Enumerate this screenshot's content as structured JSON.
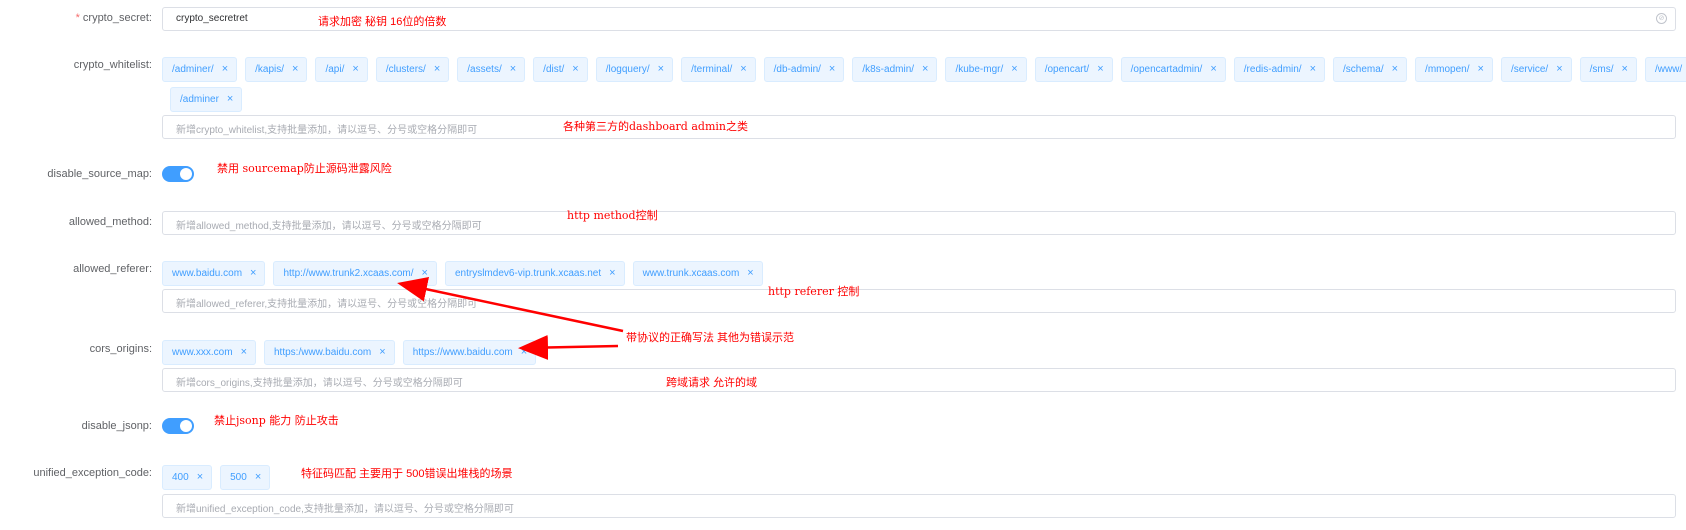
{
  "form": {
    "crypto_secret": {
      "label": "crypto_secret:",
      "required_mark": "*",
      "value": "crypto_secretret"
    },
    "crypto_whitelist": {
      "label": "crypto_whitelist:",
      "tags": [
        "/adminer/",
        "/kapis/",
        "/api/",
        "/clusters/",
        "/assets/",
        "/dist/",
        "/logquery/",
        "/terminal/",
        "/db-admin/",
        "/k8s-admin/",
        "/kube-mgr/",
        "/opencart/",
        "/opencartadmin/",
        "/redis-admin/",
        "/schema/",
        "/mmopen/",
        "/service/",
        "/sms/",
        "/www/"
      ],
      "tags_row2": [
        "/adminer"
      ],
      "placeholder": "新增crypto_whitelist,支持批量添加，请以逗号、分号或空格分隔即可"
    },
    "disable_source_map": {
      "label": "disable_source_map:",
      "enabled": true
    },
    "allowed_method": {
      "label": "allowed_method:",
      "placeholder": "新增allowed_method,支持批量添加，请以逗号、分号或空格分隔即可"
    },
    "allowed_referer": {
      "label": "allowed_referer:",
      "tags": [
        "www.baidu.com",
        "http://www.trunk2.xcaas.com/",
        "entryslmdev6-vip.trunk.xcaas.net",
        "www.trunk.xcaas.com"
      ],
      "placeholder": "新增allowed_referer,支持批量添加，请以逗号、分号或空格分隔即可"
    },
    "cors_origins": {
      "label": "cors_origins:",
      "tags": [
        "www.xxx.com",
        "https:/www.baidu.com",
        "https://www.baidu.com"
      ],
      "placeholder": "新增cors_origins,支持批量添加，请以逗号、分号或空格分隔即可"
    },
    "disable_jsonp": {
      "label": "disable_jsonp:",
      "enabled": true
    },
    "unified_exception_code": {
      "label": "unified_exception_code:",
      "tags": [
        "400",
        "500"
      ],
      "placeholder": "新增unified_exception_code,支持批量添加，请以逗号、分号或空格分隔即可"
    }
  },
  "annotations": {
    "secret": "请求加密 秘钥 16位的倍数",
    "whitelist": "各种第三方的dashboard admin之类",
    "source_map": "禁用 sourcemap防止源码泄露风险",
    "method": "http method控制",
    "referer": "http referer 控制",
    "correct_format": "带协议的正确写法   其他为错误示范",
    "cors": "跨域请求 允许的域",
    "jsonp": "禁止jsonp 能力 防止攻击",
    "exception_code": "特征码匹配 主要用于 500错误出堆栈的场景"
  },
  "colors": {
    "annotation": "#ff0000",
    "tag_text": "#409eff",
    "tag_bg": "#ecf5ff",
    "switch_on": "#409eff"
  },
  "icons": {
    "tag_close": "×",
    "clear": "⊘"
  }
}
